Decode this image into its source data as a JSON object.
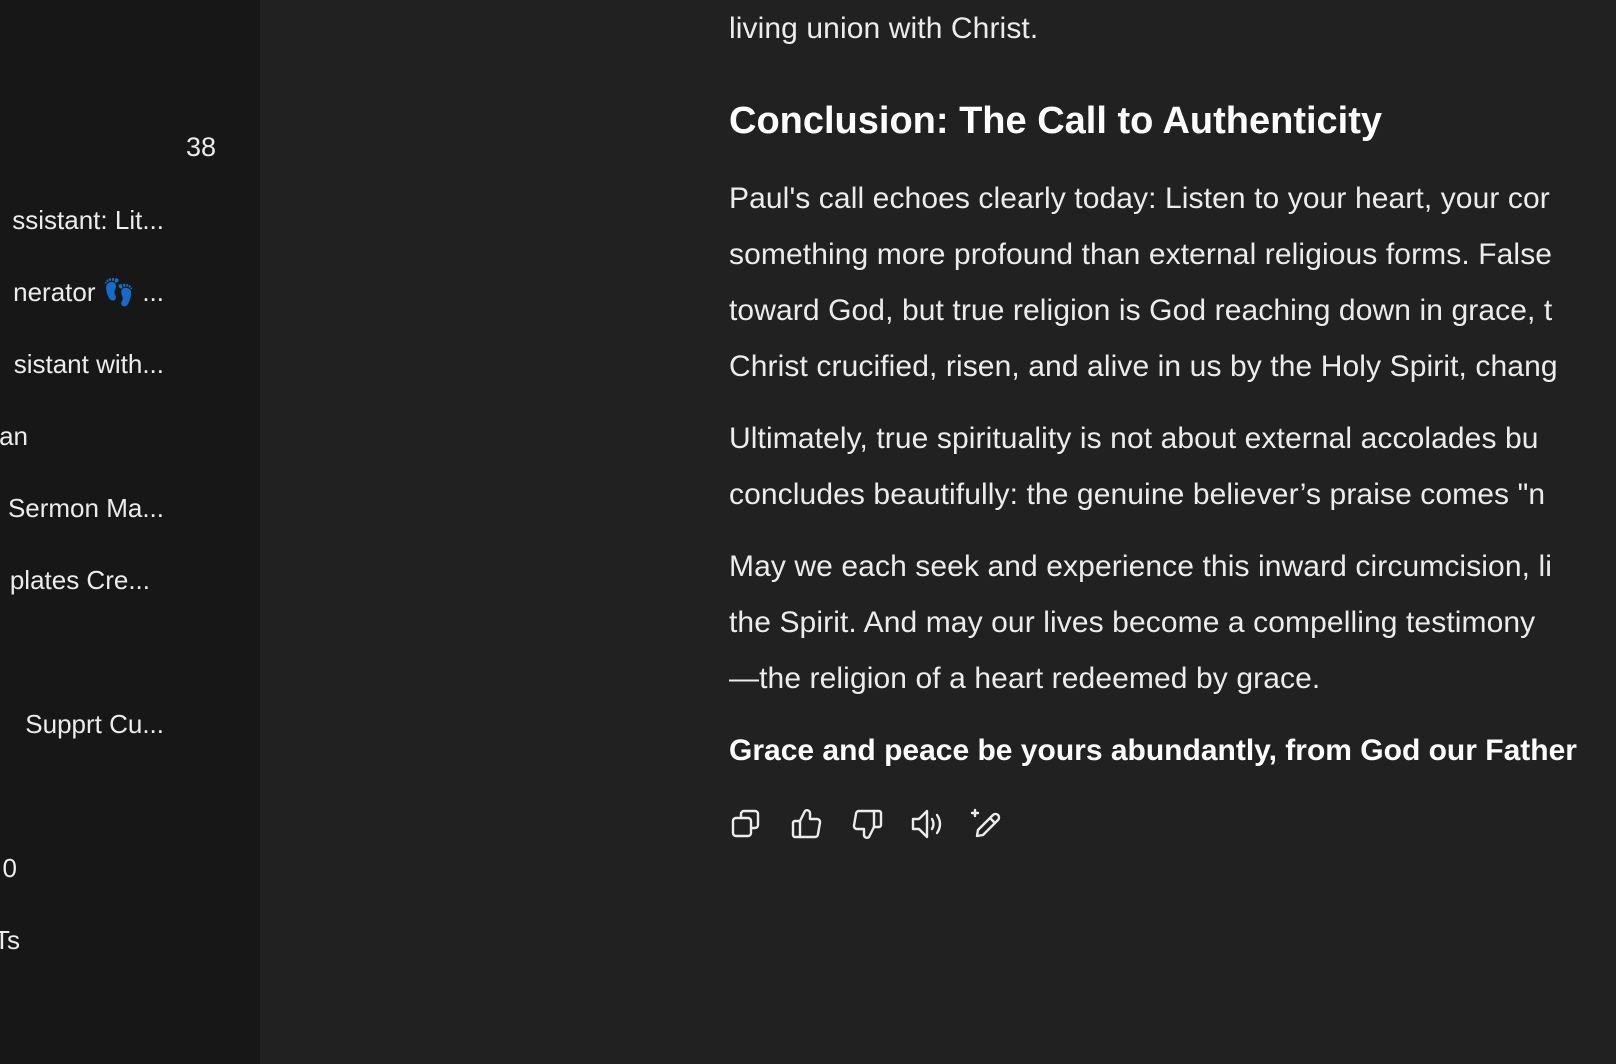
{
  "sidebar": {
    "count": "38",
    "items": [
      {
        "label": "ssistant: Lit..."
      },
      {
        "label": "nerator 👣 ..."
      },
      {
        "label": "sistant with..."
      },
      {
        "label": "an"
      },
      {
        "label": "Sermon Ma..."
      },
      {
        "label": "plates Cre..."
      },
      {
        "label": " Supprt Cu..."
      },
      {
        "label": "0"
      },
      {
        "label": "Ts"
      }
    ]
  },
  "message": {
    "line_top": "living union with Christ.",
    "heading": "Conclusion: The Call to Authenticity",
    "p1": [
      "Paul's call echoes clearly today: Listen to your heart, your cor",
      "something more profound than external religious forms. False",
      "toward God, but true religion is God reaching down in grace, t",
      "Christ crucified, risen, and alive in us by the Holy Spirit, chang"
    ],
    "p2": [
      "Ultimately, true spirituality is not about external accolades bu",
      "concludes beautifully: the genuine believer’s praise comes \"n"
    ],
    "p3": [
      "May we each seek and experience this inward circumcision, li",
      "the Spirit. And may our lives become a compelling testimony",
      "—the religion of a heart redeemed by grace."
    ],
    "closing": "Grace and peace be yours abundantly, from God our Father"
  },
  "actions": [
    {
      "icon": "copy-icon"
    },
    {
      "icon": "thumbs-up-icon"
    },
    {
      "icon": "thumbs-down-icon"
    },
    {
      "icon": "read-aloud-icon"
    },
    {
      "icon": "edit-icon"
    }
  ]
}
